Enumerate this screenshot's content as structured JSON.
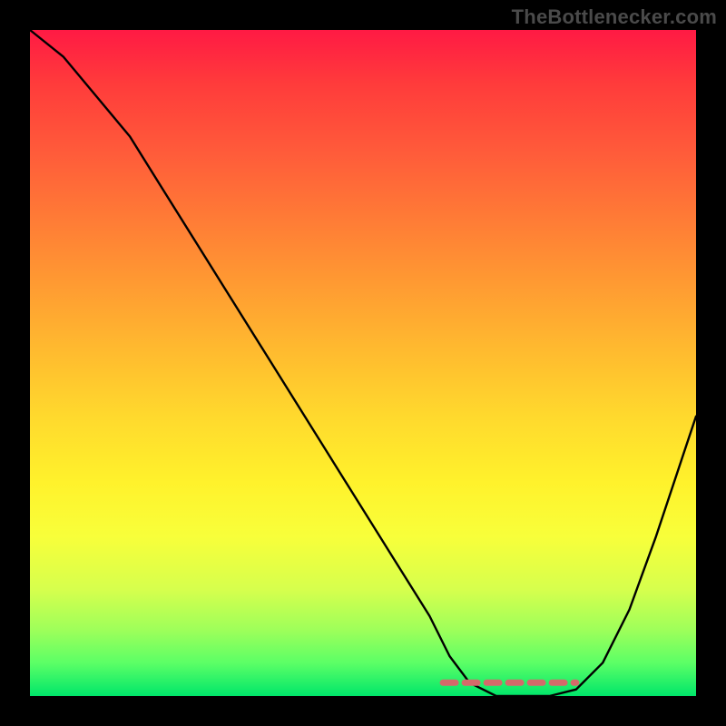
{
  "watermark": "TheBottlenecker.com",
  "colors": {
    "gradient_top": "#ff1a44",
    "gradient_bottom": "#00e66a",
    "curve": "#000000",
    "highlight": "#d46a6a",
    "frame": "#000000"
  },
  "chart_data": {
    "type": "line",
    "title": "",
    "xlabel": "",
    "ylabel": "",
    "xlim": [
      0,
      100
    ],
    "ylim": [
      0,
      100
    ],
    "grid": false,
    "legend": false,
    "series": [
      {
        "name": "bottleneck-curve",
        "x": [
          0,
          5,
          10,
          15,
          20,
          25,
          30,
          35,
          40,
          45,
          50,
          55,
          60,
          63,
          66,
          70,
          74,
          78,
          82,
          86,
          90,
          94,
          98,
          100
        ],
        "values": [
          100,
          96,
          90,
          84,
          76,
          68,
          60,
          52,
          44,
          36,
          28,
          20,
          12,
          6,
          2,
          0,
          0,
          0,
          1,
          5,
          13,
          24,
          36,
          42
        ]
      }
    ],
    "annotations": [
      {
        "name": "sweet-spot-band",
        "x_range": [
          62,
          82
        ],
        "y": 2,
        "color": "#d46a6a"
      }
    ]
  }
}
